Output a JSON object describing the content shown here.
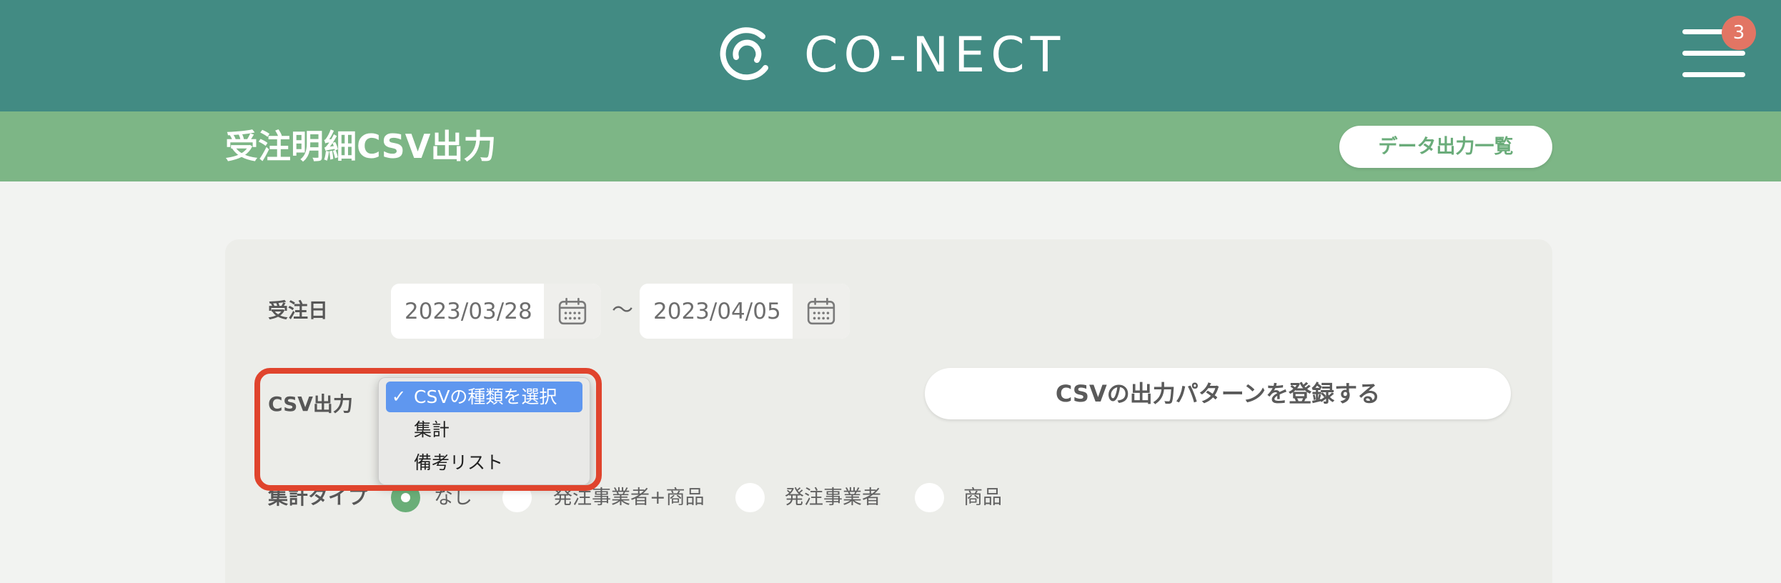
{
  "header": {
    "brand": "CO-NECT",
    "menu_badge": "3"
  },
  "subheader": {
    "title": "受注明細CSV出力",
    "list_button": "データ出力一覧"
  },
  "form": {
    "order_date": {
      "label": "受注日",
      "from": "2023/03/28",
      "separator": "〜",
      "to": "2023/04/05"
    },
    "csv_output": {
      "label": "CSV出力",
      "check_mark": "✓",
      "options": [
        {
          "label": "CSVの種類を選択",
          "selected": true
        },
        {
          "label": "集計",
          "selected": false
        },
        {
          "label": "備考リスト",
          "selected": false
        }
      ]
    },
    "register_pattern_button": "CSVの出力パターンを登録する",
    "aggregate_type": {
      "label": "集計タイプ",
      "options": [
        {
          "label": "なし",
          "checked": true
        },
        {
          "label": "発注事業者+商品",
          "checked": false
        },
        {
          "label": "発注事業者",
          "checked": false
        },
        {
          "label": "商品",
          "checked": false
        }
      ]
    }
  },
  "icons": {
    "logo": "conect-logo-icon",
    "menu": "hamburger-menu-icon",
    "calendar": "calendar-icon",
    "check": "checkmark-icon"
  },
  "colors": {
    "header_bg": "#428b83",
    "subheader_bg": "#7db686",
    "page_bg": "#f2f3f1",
    "card_bg": "#ecede9",
    "accent_green": "#6aae78",
    "selection_blue": "#5f97ef",
    "annotation_red": "#e0442d",
    "badge_bg": "#e27564"
  }
}
